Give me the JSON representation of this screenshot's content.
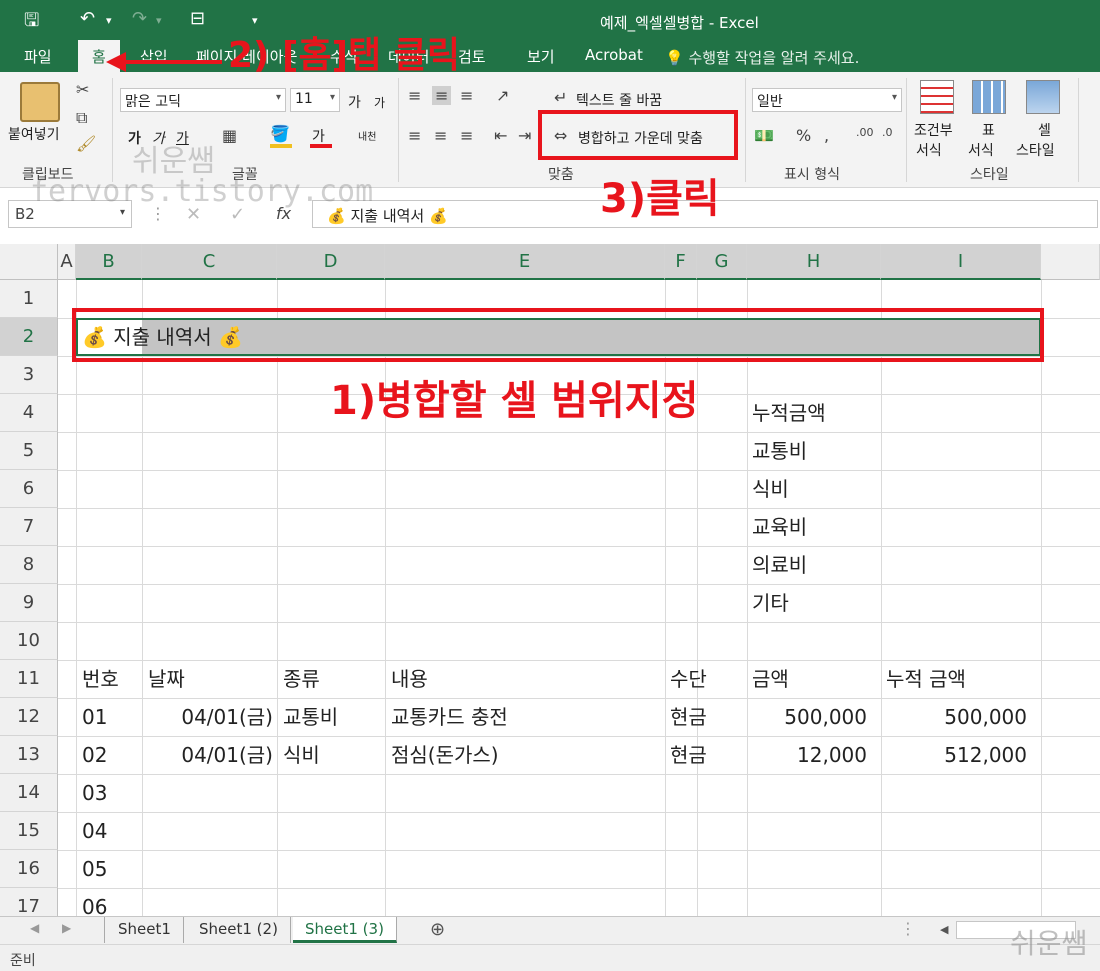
{
  "window": {
    "title": "예제_엑셀셀병합 - Excel"
  },
  "tabs": [
    {
      "label": "파일"
    },
    {
      "label": "홈"
    },
    {
      "label": "삽입"
    },
    {
      "label": "페이지 레이아웃"
    },
    {
      "label": "수식"
    },
    {
      "label": "데이터"
    },
    {
      "label": "검토"
    },
    {
      "label": "보기"
    },
    {
      "label": "Acrobat"
    }
  ],
  "tell_me": "수행할 작업을 알려 주세요.",
  "ribbon": {
    "clipboard": {
      "paste_label": "붙여넣기",
      "group_label": "클립보드"
    },
    "font": {
      "font_name": "맑은 고딕",
      "font_size": "11",
      "group_label": "글꼴",
      "grow": "가",
      "shrink": "가",
      "bold": "가",
      "italic": "가",
      "underline": "가",
      "font_color_glyph": "가",
      "phonetic": "내천"
    },
    "alignment": {
      "wrap_text": "텍스트 줄 바꿈",
      "merge_center": "병합하고 가운데 맞춤",
      "group_label": "맞춤"
    },
    "number": {
      "format": "일반",
      "group_label": "표시 형식"
    },
    "styles": {
      "conditional_1": "조건부",
      "conditional_2": "서식",
      "table_1": "표",
      "table_2": "서식",
      "cell_1": "셀",
      "cell_2": "스타일",
      "group_label": "스타일"
    }
  },
  "formula_bar": {
    "name_box": "B2",
    "fx": "fx",
    "content": "💰 지출 내역서 💰"
  },
  "columns": [
    "A",
    "B",
    "C",
    "D",
    "E",
    "F",
    "G",
    "H",
    "I"
  ],
  "rows": [
    "1",
    "2",
    "3",
    "4",
    "5",
    "6",
    "7",
    "8",
    "9",
    "10",
    "11",
    "12",
    "13",
    "14",
    "15",
    "16",
    "17"
  ],
  "sheet": {
    "b2_title": "💰 지출 내역서 💰",
    "categories": [
      "누적금액",
      "교통비",
      "식비",
      "교육비",
      "의료비",
      "기타"
    ],
    "table_headers": [
      "번호",
      "날짜",
      "종류",
      "내용",
      "수단",
      "금액",
      "누적 금액"
    ],
    "data_rows": [
      [
        "01",
        "04/01(금)",
        "교통비",
        "교통카드 충전",
        "현금",
        "500,000",
        "500,000"
      ],
      [
        "02",
        "04/01(금)",
        "식비",
        "점심(돈가스)",
        "현금",
        "12,000",
        "512,000"
      ]
    ],
    "numbers_rest": [
      "03",
      "04",
      "05",
      "06"
    ]
  },
  "sheet_tabs": [
    {
      "label": "Sheet1"
    },
    {
      "label": "Sheet1 (2)"
    },
    {
      "label": "Sheet1 (3)"
    }
  ],
  "status": "준비",
  "annotations": {
    "step1": "1)병합할 셀 범위지정",
    "step2": "2) [홈]탭 클릭",
    "step3": "3)클릭"
  },
  "watermark": {
    "name": "쉬운쌤",
    "url": "fervors.tistory.com"
  },
  "colors": {
    "excel_green": "#217346",
    "annotation_red": "#e8141c",
    "selection_gray": "#c4c4c4"
  }
}
